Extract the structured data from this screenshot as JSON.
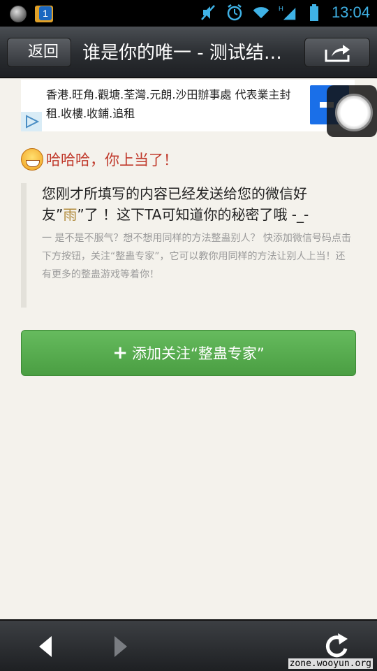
{
  "status_bar": {
    "notification_count": "1",
    "time": "13:04",
    "icons": [
      "mute-icon",
      "alarm-icon",
      "wifi-icon",
      "signal-icon",
      "battery-icon"
    ],
    "network_label": "H"
  },
  "top_bar": {
    "back_label": "返回",
    "title": "谁是你的唯一 - 测试结…",
    "share_icon": "share-icon"
  },
  "ad": {
    "text": "香港.旺角.觀塘.荃灣.元朗.沙田辦事處 代表業主封租.收樓.收鋪.追租"
  },
  "content": {
    "headline": "哈哈哈，你上当了！",
    "message_part1": "您刚才所填写的内容已经发送给您的微信好友”",
    "friend_name": "雨",
    "message_part2": "”了 ！这下TA可知道你的秘密了哦 -_-",
    "sub_text": "一 是不是不服气？想不想用同样的方法整蛊别人？ 快添加微信号码点击下方按钮，关注“整蛊专家”，它可以教你用同样的方法让别人上当！还有更多的整蛊游戏等着你！",
    "follow_button_label": "添加关注“整蛊专家”"
  },
  "bottom_bar": {
    "watermark": "zone.wooyun.org"
  },
  "colors": {
    "headline": "#c0392b",
    "button_green": "#5cb354",
    "status_accent": "#3fb2e6",
    "background": "#f4f2ec"
  }
}
